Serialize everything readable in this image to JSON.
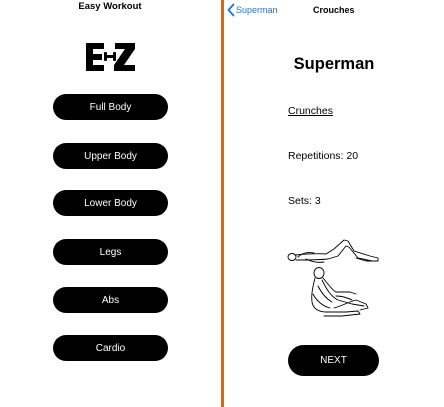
{
  "home": {
    "title": "Easy Workout",
    "logo_text": "E-Z",
    "menu": [
      {
        "label": "Full Body"
      },
      {
        "label": "Upper Body"
      },
      {
        "label": "Lower Body"
      },
      {
        "label": "Legs"
      },
      {
        "label": "Abs"
      },
      {
        "label": "Cardio"
      }
    ]
  },
  "detail": {
    "nav": {
      "back_label": "Superman",
      "title": "Crouches"
    },
    "workout_title": "Superman",
    "exercise_name": "Crunches",
    "repetitions": "Repetitions: 20",
    "sets": "Sets: 3",
    "next_label": "NEXT",
    "icons": {
      "back": "chevron-left-icon",
      "illustration": "crunches-illustration"
    }
  },
  "colors": {
    "divider": "#d2691e",
    "button_bg": "#000000",
    "button_text": "#ffffff",
    "link": "#1a73e8"
  }
}
